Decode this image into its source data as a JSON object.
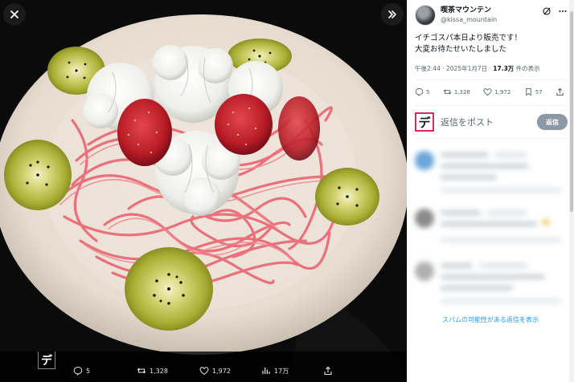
{
  "viewer": {
    "close_icon": "close-icon",
    "expand_icon": "chevrons-right-icon",
    "bar": {
      "logo_char": "デ",
      "replies": "5",
      "reposts": "1,328",
      "likes": "1,972",
      "views": "17万"
    }
  },
  "panel": {
    "author": {
      "display_name": "喫茶マウンテン",
      "handle": "@kissa_mountain"
    },
    "post": {
      "line1": "イチゴスパ本日より販売です！",
      "line2": "大変お待たせいたしました"
    },
    "meta": {
      "time_date": "午後2:44 · 2025年1月7日 · ",
      "views": "17.3万",
      "views_suffix": " 件の表示"
    },
    "actions": {
      "replies": "5",
      "reposts": "1,328",
      "likes": "1,972",
      "bookmarks": "57"
    },
    "reply_box": {
      "logo_char": "デ",
      "placeholder": "返信をポスト",
      "button": "返信"
    },
    "spam_link": "スパムの可能性がある返信を表示"
  },
  "colors": {
    "link": "#1d9bf0",
    "reply_button": "#8b98a5",
    "logo_border": "#e0245e"
  }
}
